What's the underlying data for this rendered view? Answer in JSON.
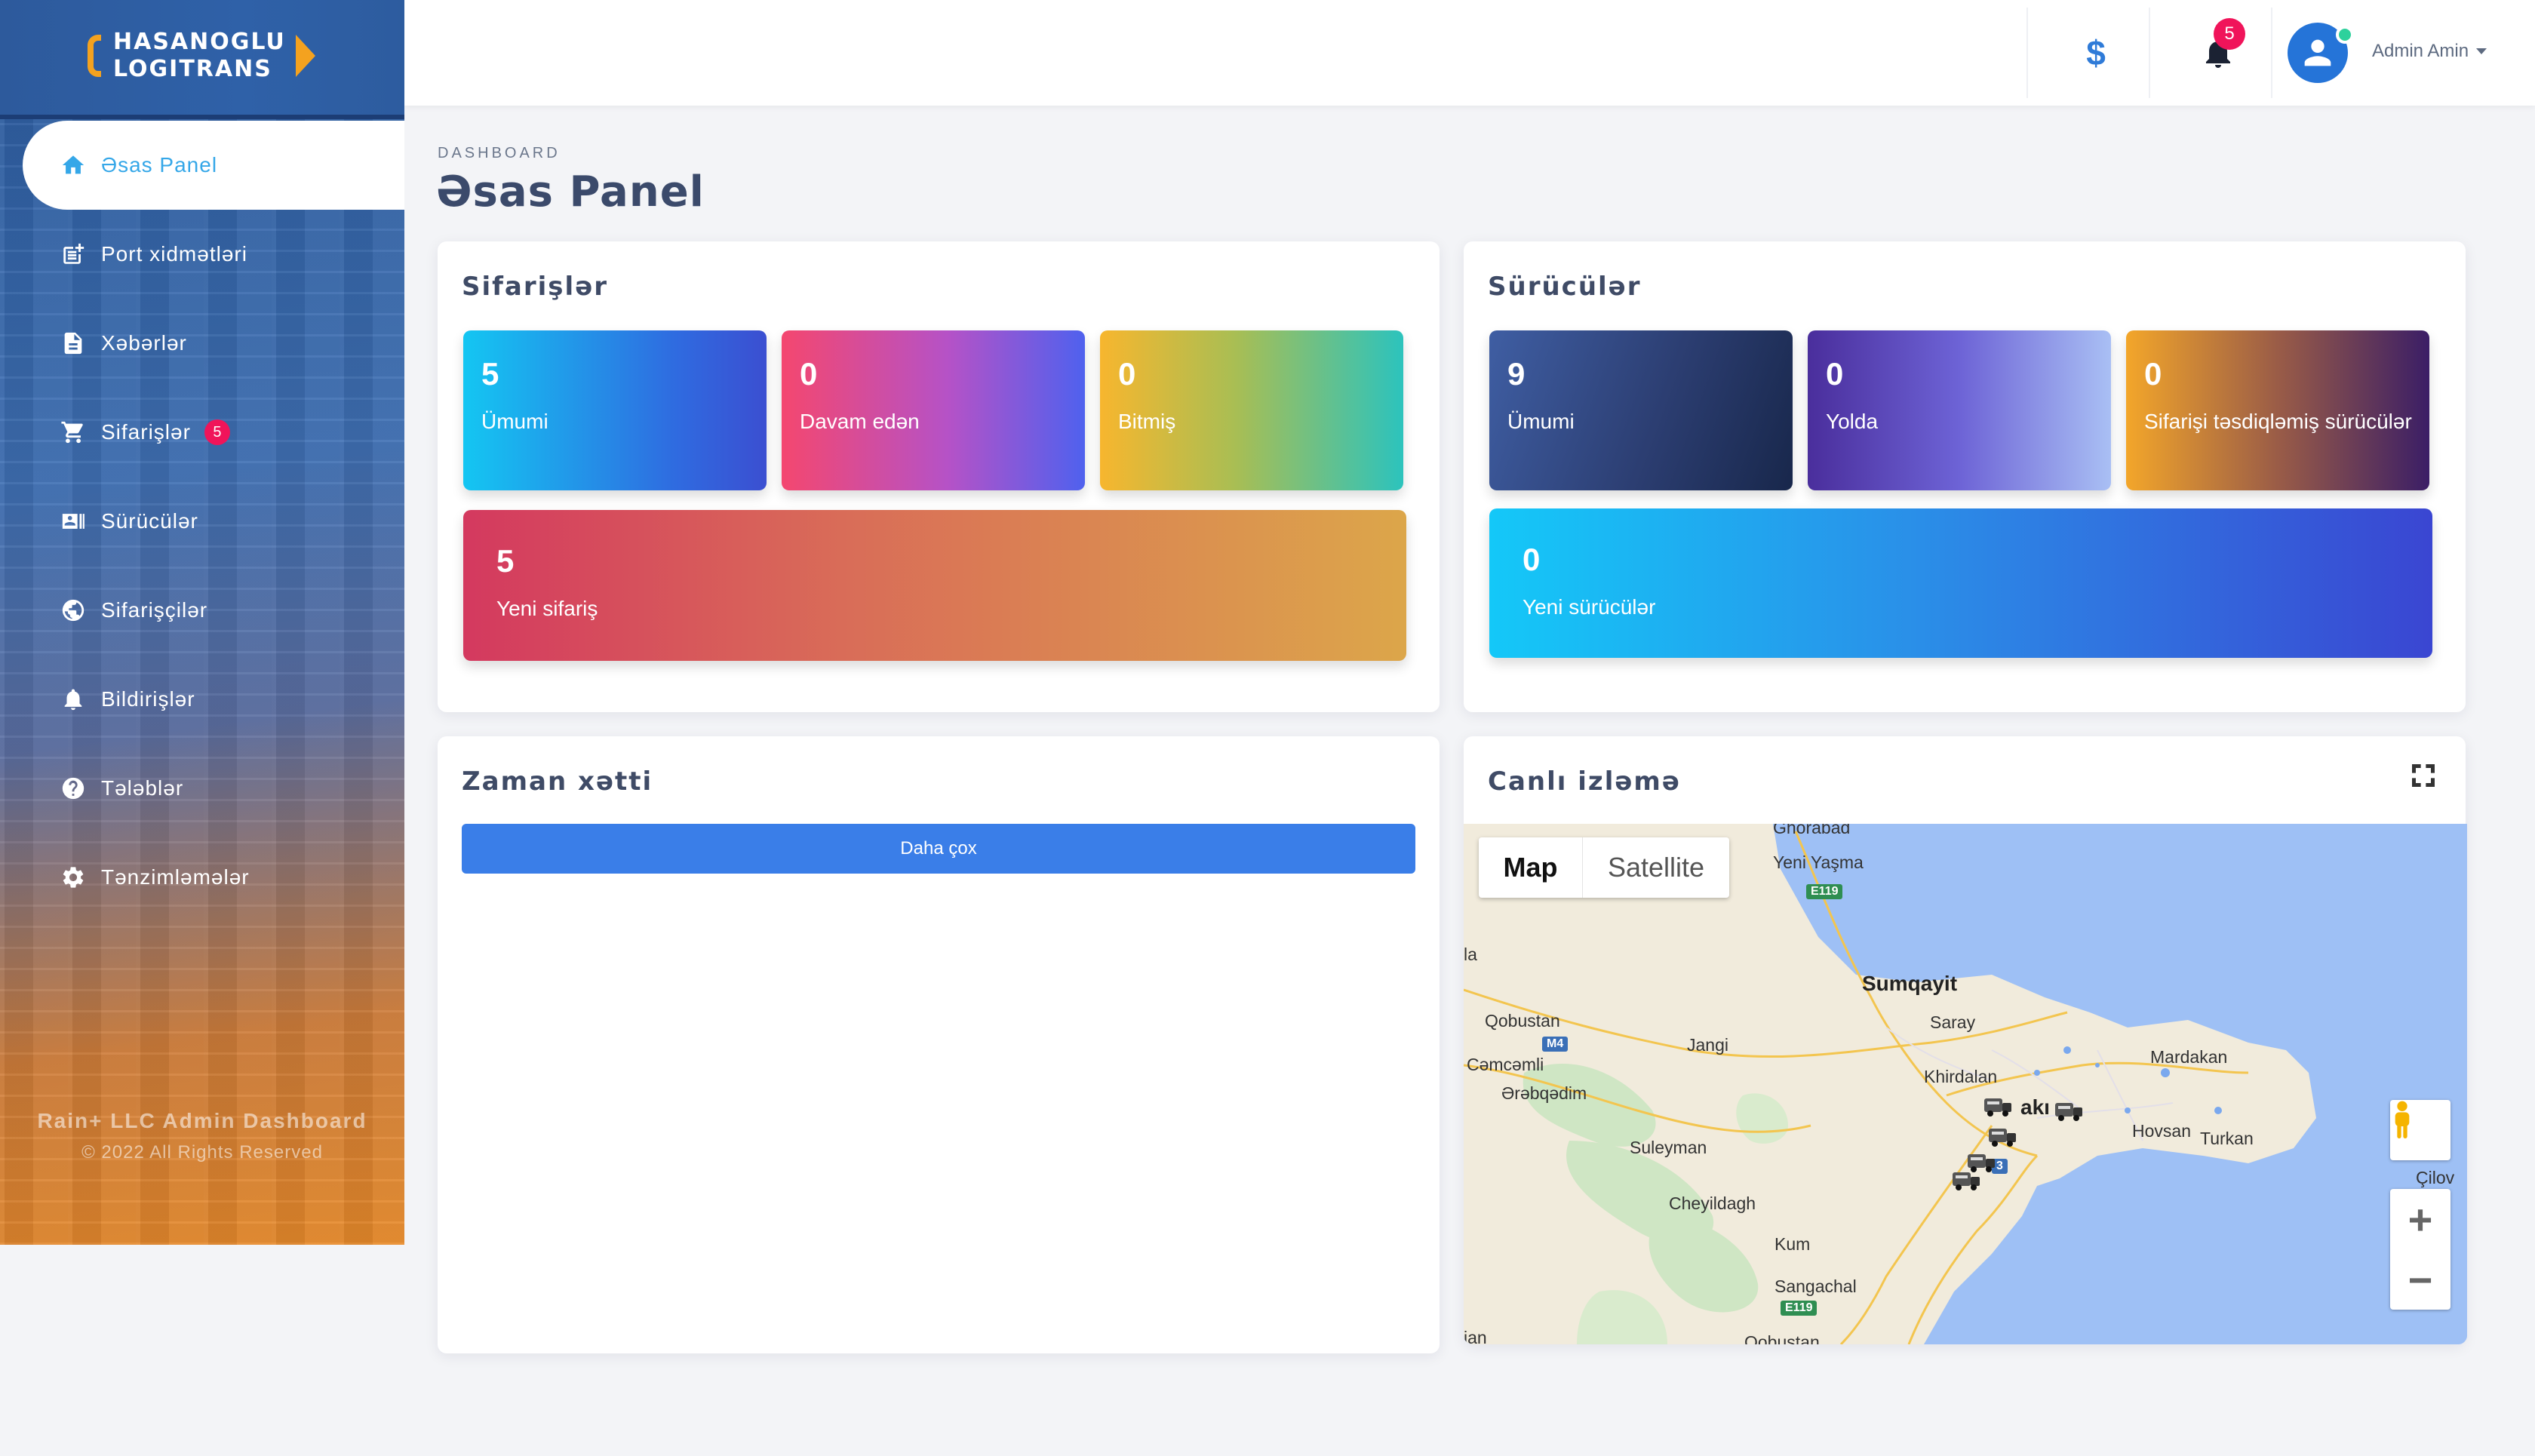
{
  "brand": {
    "line1": "HASANOGLU",
    "line2": "LOGITRANS",
    "color": "#f4a21f"
  },
  "sidebar": {
    "items": [
      {
        "label": "Əsas Panel",
        "icon": "home-icon",
        "active": true
      },
      {
        "label": "Port xidmətləri",
        "icon": "post-add-icon"
      },
      {
        "label": "Xəbərlər",
        "icon": "document-icon"
      },
      {
        "label": "Sifarişlər",
        "icon": "cart-icon",
        "badge": "5"
      },
      {
        "label": "Sürücülər",
        "icon": "id-card-icon"
      },
      {
        "label": "Sifarişçilər",
        "icon": "globe-icon"
      },
      {
        "label": "Bildirişlər",
        "icon": "bell-icon"
      },
      {
        "label": "Tələblər",
        "icon": "help-icon"
      },
      {
        "label": "Tənzimləmələr",
        "icon": "gear-icon"
      }
    ],
    "footer_title": "Rain+ LLC Admin Dashboard",
    "footer_copy": "© 2022 All Rights Reserved"
  },
  "header": {
    "dollar_icon": "$",
    "notifications_count": "5",
    "user_name": "Admin Amin"
  },
  "page": {
    "breadcrumb": "DASHBOARD",
    "title": "Əsas Panel"
  },
  "orders_card": {
    "title": "Sifarişlər",
    "stats": [
      {
        "value": "5",
        "label": "Ümumi"
      },
      {
        "value": "0",
        "label": "Davam edən"
      },
      {
        "value": "0",
        "label": "Bitmiş"
      }
    ],
    "new": {
      "value": "5",
      "label": "Yeni sifariş"
    }
  },
  "drivers_card": {
    "title": "Sürücülər",
    "stats": [
      {
        "value": "9",
        "label": "Ümumi"
      },
      {
        "value": "0",
        "label": "Yolda"
      },
      {
        "value": "0",
        "label": "Sifarişi təsdiqləmiş sürücülər"
      }
    ],
    "new": {
      "value": "0",
      "label": "Yeni sürücülər"
    }
  },
  "timeline_card": {
    "title": "Zaman xətti",
    "more_label": "Daha çox"
  },
  "tracking_card": {
    "title": "Canlı izləmə",
    "map_type": {
      "map": "Map",
      "satellite": "Satellite"
    },
    "labels": {
      "yeni_yasma": "Yeni Yaşma",
      "sumqayit": "Sumqayit",
      "saray": "Saray",
      "qobustan": "Qobustan",
      "jangi": "Jangi",
      "camcamli": "Cəmcəmli",
      "arabqadim": "Ərəbqədim",
      "khirdalan": "Khirdalan",
      "mardakan": "Mardakan",
      "baku": "akı",
      "hovsan": "Hovsan",
      "turkan": "Turkan",
      "cilov": "Çilov",
      "suleyman": "Suleyman",
      "cheyildagh": "Cheyildagh",
      "kum": "Kum",
      "sangachal": "Sangachal",
      "la": "la",
      "an": "ian",
      "ghorabad": "Ghorabad",
      "qobustan_bottom": "Qobustan"
    },
    "signs": {
      "e119_top": "E119",
      "m4": "M4",
      "e119_bottom": "E119",
      "m3": "3"
    }
  }
}
